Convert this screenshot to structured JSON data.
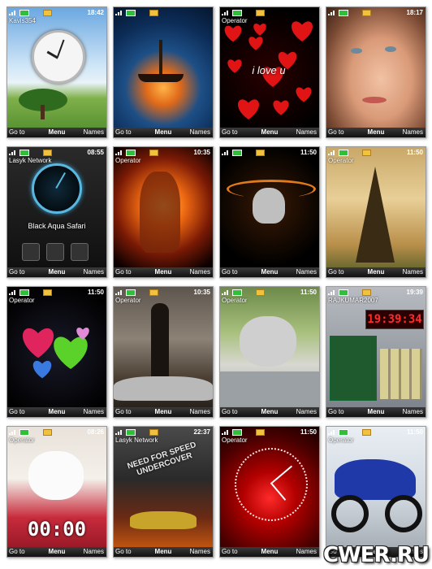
{
  "screenshots": [
    {
      "operator": "Kavis354",
      "time": "18:42",
      "left": "Go to",
      "mid": "Menu",
      "right": "Names",
      "scene": "clock-tree"
    },
    {
      "operator": "",
      "time": "",
      "left": "Go to",
      "mid": "Menu",
      "right": "Names",
      "scene": "ship"
    },
    {
      "operator": "Operator",
      "time": "",
      "left": "Go to",
      "mid": "Menu",
      "right": "Names",
      "scene": "hearts-red",
      "overlay": "i love u"
    },
    {
      "operator": "",
      "time": "18:17",
      "left": "Go to",
      "mid": "Menu",
      "right": "Names",
      "scene": "face"
    },
    {
      "operator": "Lasyk Network",
      "time": "08:55",
      "left": "Go to",
      "mid": "Menu",
      "right": "Names",
      "scene": "aqua",
      "overlay": "Black Aqua Safari"
    },
    {
      "operator": "Operator",
      "time": "10:35",
      "left": "Go to",
      "mid": "Menu",
      "right": "Names",
      "scene": "fire"
    },
    {
      "operator": "",
      "time": "11:50",
      "left": "Go to",
      "mid": "Menu",
      "right": "Names",
      "scene": "skull"
    },
    {
      "operator": "Operator",
      "time": "11:50",
      "left": "Go to",
      "mid": "Menu",
      "right": "Names",
      "scene": "eiffel"
    },
    {
      "operator": "Operator",
      "time": "11:50",
      "left": "Go to",
      "mid": "Menu",
      "right": "Names",
      "scene": "hearts-color"
    },
    {
      "operator": "Operator",
      "time": "10:35",
      "left": "Go to",
      "mid": "Menu",
      "right": "Names",
      "scene": "car-girl"
    },
    {
      "operator": "Operator",
      "time": "11:50",
      "left": "Go to",
      "mid": "Menu",
      "right": "Names",
      "scene": "kitten"
    },
    {
      "operator": "RAJKUMAR2007",
      "time": "19:39",
      "left": "Go to",
      "mid": "Menu",
      "right": "Names",
      "scene": "digital-board",
      "overlay": "19:39:34"
    },
    {
      "operator": "Operator",
      "time": "08:26",
      "left": "Go to",
      "mid": "Menu",
      "right": "Names",
      "scene": "puppy",
      "overlay": "00:00"
    },
    {
      "operator": "Lasyk Network",
      "time": "22:37",
      "left": "Go to",
      "mid": "Menu",
      "right": "Names",
      "scene": "nfs",
      "overlay": "NEED FOR SPEED UNDERCOVER"
    },
    {
      "operator": "Operator",
      "time": "11:50",
      "left": "Go to",
      "mid": "Menu",
      "right": "Names",
      "scene": "rose-clock"
    },
    {
      "operator": "Operator",
      "time": "11:50",
      "left": "Go to",
      "mid": "Menu",
      "right": "Names",
      "scene": "motorbike"
    }
  ],
  "watermark": "CWER.RU"
}
